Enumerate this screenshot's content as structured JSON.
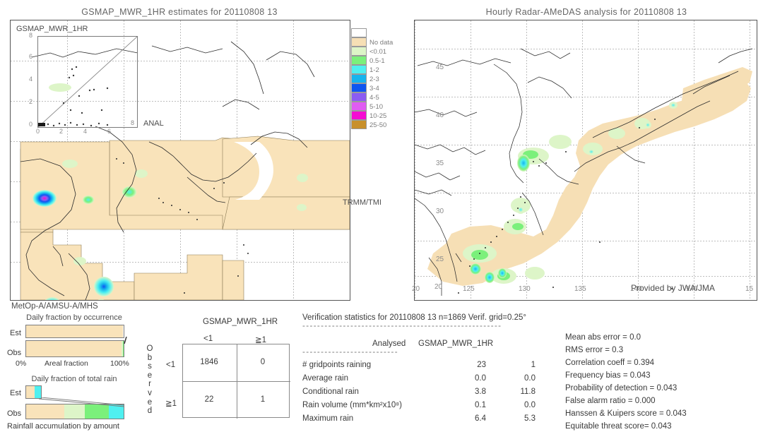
{
  "left_panel": {
    "title": "GSMAP_MWR_1HR estimates for 20110808 13",
    "inset_title": "GSMAP_MWR_1HR",
    "inset_y_ticks": [
      "8",
      "6",
      "4",
      "2",
      "0"
    ],
    "inset_x_ticks": [
      "0",
      "2",
      "4",
      "6",
      "8"
    ],
    "inset_x_axis_label": "ANAL",
    "sensor_tag": "TRMM/TMI",
    "footer_tag": "MetOp-A/AMSU-A/MHS"
  },
  "right_panel": {
    "title": "Hourly Radar-AMeDAS analysis for 20110808 13",
    "x_ticks": [
      "20",
      "125",
      "130",
      "135",
      "140",
      "145",
      "15"
    ],
    "y_ticks": [
      "45",
      "40",
      "35",
      "30",
      "25",
      "20"
    ],
    "inner_label": "20",
    "credit": "Provided by JWA/JMA"
  },
  "colorbar": {
    "entries": [
      {
        "label": "",
        "color": "#ffffff"
      },
      {
        "label": "No data",
        "color": "#f6dfb5"
      },
      {
        "label": "<0.01",
        "color": "#ddf5c8"
      },
      {
        "label": "0.5-1",
        "color": "#7bf07b"
      },
      {
        "label": "1-2",
        "color": "#4ff0f0"
      },
      {
        "label": "2-3",
        "color": "#17b4ee"
      },
      {
        "label": "3-4",
        "color": "#0f56f0"
      },
      {
        "label": "4-5",
        "color": "#8c5cf2"
      },
      {
        "label": "5-10",
        "color": "#e05cf2"
      },
      {
        "label": "10-25",
        "color": "#f50cd2"
      },
      {
        "label": "25-50",
        "color": "#c8902c"
      }
    ]
  },
  "fraction_charts": {
    "occurrence": {
      "title": "Daily fraction by occurrence",
      "left_axis_label": "0%",
      "center_axis_label": "Areal fraction",
      "right_axis_label": "100%",
      "rows": [
        {
          "label": "Est",
          "segments": [
            {
              "color": "#f9e3ba",
              "pct": 99.5
            },
            {
              "color": "#ffffff",
              "pct": 0.5
            }
          ]
        },
        {
          "label": "Obs",
          "segments": [
            {
              "color": "#f9e3ba",
              "pct": 98.0
            },
            {
              "color": "#ddf5c8",
              "pct": 1.3
            },
            {
              "color": "#7bf07b",
              "pct": 0.7
            }
          ]
        }
      ]
    },
    "total_rain": {
      "title": "Daily fraction of total rain",
      "bottom_label": "Rainfall accumulation by amount",
      "rows": [
        {
          "label": "Est",
          "width_pct": 16,
          "segments": [
            {
              "color": "#f9e3ba",
              "pct": 55
            },
            {
              "color": "#4ff0f0",
              "pct": 45
            }
          ]
        },
        {
          "label": "Obs",
          "width_pct": 100,
          "segments": [
            {
              "color": "#f9e3ba",
              "pct": 39
            },
            {
              "color": "#ddf5c8",
              "pct": 21
            },
            {
              "color": "#7bf07b",
              "pct": 25
            },
            {
              "color": "#4ff0f0",
              "pct": 15
            }
          ]
        }
      ]
    }
  },
  "contingency": {
    "title": "GSMAP_MWR_1HR",
    "col_headers": [
      "<1",
      "≧1"
    ],
    "row_headers": [
      "<1",
      "≧1"
    ],
    "observed_label": "Observed",
    "cells": [
      [
        "1846",
        "0"
      ],
      [
        "22",
        "1"
      ]
    ]
  },
  "verification": {
    "header": "Verification statistics for 20110808 13  n=1869  Verif. grid=0.25°",
    "divider": "------------------------------------------------------",
    "col_headers": [
      "Analysed",
      "GSMAP_MWR_1HR"
    ],
    "sub_divider": "--------------------------",
    "rows": [
      {
        "metric": "# gridpoints raining",
        "analysed": "23",
        "estimate": "1"
      },
      {
        "metric": "Average rain",
        "analysed": "0.0",
        "estimate": "0.0"
      },
      {
        "metric": "Conditional rain",
        "analysed": "3.8",
        "estimate": "11.8"
      },
      {
        "metric": "Rain volume (mm*km²x10⁸)",
        "analysed": "0.1",
        "estimate": "0.0"
      },
      {
        "metric": "Maximum rain",
        "analysed": "6.4",
        "estimate": "5.3"
      }
    ],
    "scores": [
      "Mean abs error = 0.0",
      "RMS error = 0.3",
      "Correlation coeff = 0.394",
      "Frequency bias = 0.043",
      "Probability of detection = 0.043",
      "False alarm ratio = 0.000",
      "Hanssen & Kuipers score = 0.043",
      "Equitable threat score= 0.043"
    ]
  }
}
